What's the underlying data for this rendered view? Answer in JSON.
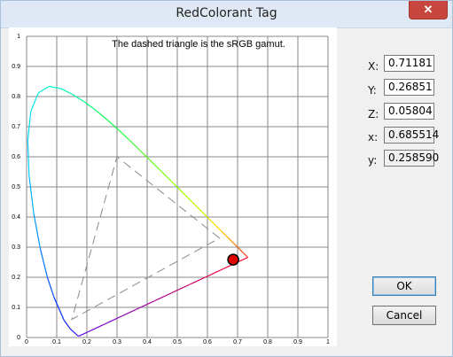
{
  "window": {
    "title": "RedColorant Tag",
    "close_glyph": "✕"
  },
  "plot": {
    "caption": "The dashed triangle is the sRGB gamut.",
    "x_ticks": [
      "0",
      "0.1",
      "0.2",
      "0.3",
      "0.4",
      "0.5",
      "0.6",
      "0.7",
      "0.8",
      "0.9",
      "1"
    ],
    "y_ticks": [
      "0",
      "0.1",
      "0.2",
      "0.3",
      "0.4",
      "0.5",
      "0.6",
      "0.7",
      "0.8",
      "0.9",
      "1"
    ],
    "srgb_gamut": [
      [
        0.64,
        0.33
      ],
      [
        0.3,
        0.6
      ],
      [
        0.15,
        0.06
      ]
    ],
    "marker_point": {
      "x": 0.685514,
      "y": 0.25859
    },
    "marker_color": "#e00000"
  },
  "fields": {
    "X": {
      "label": "X:",
      "value": "0.71181"
    },
    "Y": {
      "label": "Y:",
      "value": "0.26851"
    },
    "Z": {
      "label": "Z:",
      "value": "0.05804"
    },
    "x": {
      "label": "x:",
      "value": "0.685514"
    },
    "y": {
      "label": "y:",
      "value": "0.258590"
    }
  },
  "buttons": {
    "ok": "OK",
    "cancel": "Cancel"
  }
}
